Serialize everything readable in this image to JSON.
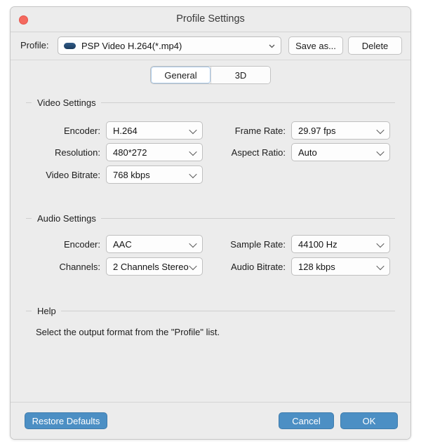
{
  "window": {
    "title": "Profile Settings",
    "close_icon": "close-dot-icon",
    "accent_blue": "#4c8fc4",
    "close_red": "#f4695e",
    "background": "#ececec"
  },
  "profile_row": {
    "label": "Profile:",
    "icon": "psp-device-icon",
    "value": "PSP Video H.264(*.mp4)",
    "save_as_label": "Save as...",
    "delete_label": "Delete"
  },
  "tabs": [
    {
      "label": "General",
      "active": true
    },
    {
      "label": "3D",
      "active": false
    }
  ],
  "video_settings": {
    "title": "Video Settings",
    "fields": [
      {
        "label": "Encoder:",
        "value": "H.264"
      },
      {
        "label": "Resolution:",
        "value": "480*272"
      },
      {
        "label": "Video Bitrate:",
        "value": "768 kbps"
      },
      {
        "label": "Frame Rate:",
        "value": "29.97 fps"
      },
      {
        "label": "Aspect Ratio:",
        "value": "Auto"
      }
    ]
  },
  "audio_settings": {
    "title": "Audio Settings",
    "fields": [
      {
        "label": "Encoder:",
        "value": "AAC"
      },
      {
        "label": "Channels:",
        "value": "2 Channels Stereo"
      },
      {
        "label": "Sample Rate:",
        "value": "44100 Hz"
      },
      {
        "label": "Audio Bitrate:",
        "value": "128 kbps"
      }
    ]
  },
  "help": {
    "title": "Help",
    "text": "Select the output format from the \"Profile\" list."
  },
  "footer": {
    "restore_defaults_label": "Restore Defaults",
    "cancel_label": "Cancel",
    "ok_label": "OK"
  }
}
